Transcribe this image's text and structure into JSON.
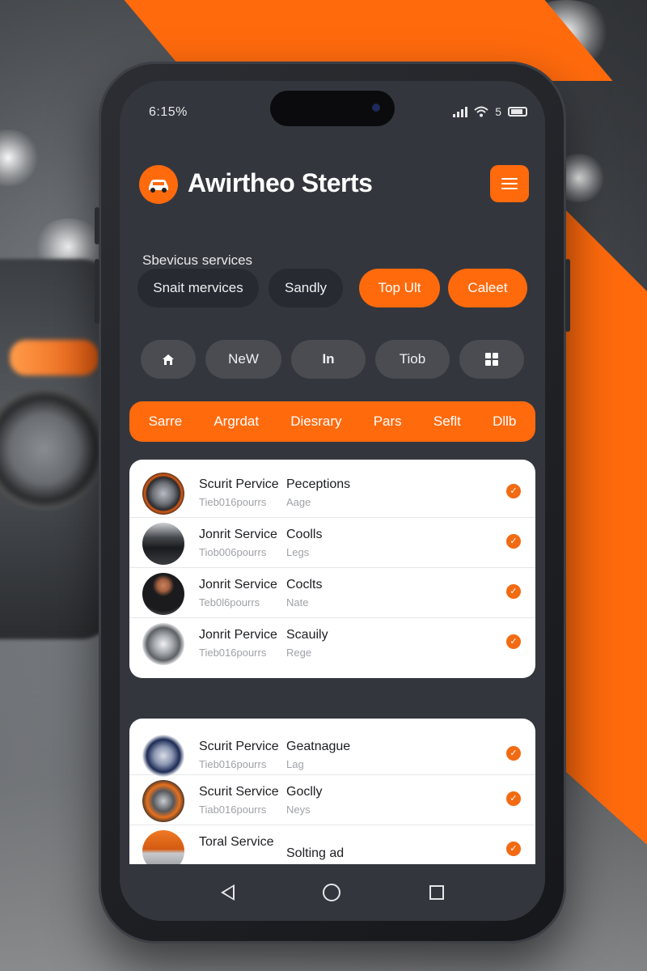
{
  "status_bar": {
    "time": "6:15%",
    "network": "5"
  },
  "header": {
    "app_title": "Awirtheo Sterts",
    "logo_icon": "car-icon",
    "menu_icon": "hamburger-icon"
  },
  "services": {
    "label": "Sbevicus services",
    "chips": [
      {
        "label": "Snait mervices",
        "style": "dark"
      },
      {
        "label": "Sandly",
        "style": "dark"
      },
      {
        "label": "Top Ult",
        "style": "orange"
      },
      {
        "label": "Caleet",
        "style": "orange"
      }
    ]
  },
  "quick_nav": [
    {
      "label": "",
      "icon": "home-icon"
    },
    {
      "label": "NeW"
    },
    {
      "label": "In"
    },
    {
      "label": "Tiob"
    },
    {
      "label": "",
      "icon": "grid-icon"
    }
  ],
  "categories": [
    "Sarre",
    "Argrdat",
    "Diesrary",
    "Pars",
    "Seflt",
    "Dllb"
  ],
  "list_card_1": [
    {
      "title": "Scurit Pervice",
      "title_2": "Peceptions",
      "subtitle": "Tieb016pourrs",
      "subtitle_2": "Aage",
      "avatar": "brake-rotor"
    },
    {
      "title": "Jonrit Service",
      "title_2": "Coolls",
      "subtitle": "Tiob006pourrs",
      "subtitle_2": "Legs",
      "avatar": "car-front"
    },
    {
      "title": "Jonrit Service",
      "title_2": "Coclts",
      "subtitle": "Teb0l6pourrs",
      "subtitle_2": "Nate",
      "avatar": "mechanic"
    },
    {
      "title": "Jonrit Pervice",
      "title_2": "Scauily",
      "subtitle": "Tieb016pourrs",
      "subtitle_2": "Rege",
      "avatar": "wheel-rim"
    }
  ],
  "list_card_2": [
    {
      "title": "Scurit Pervice",
      "title_2": "Geatnague",
      "subtitle": "Tieb016pourrs",
      "subtitle_2": "Lag",
      "avatar": "badge"
    },
    {
      "title": "Scurit Service",
      "title_2": "Goclly",
      "subtitle": "Tiab016pourrs",
      "subtitle_2": "Neys",
      "avatar": "engine"
    },
    {
      "title": "Toral Service",
      "title_2": "Solting ad",
      "subtitle": "",
      "subtitle_2": "",
      "avatar": "orange-part"
    }
  ],
  "colors": {
    "accent": "#ff6a0d",
    "screen_bg": "#34363d",
    "card_bg": "#ffffff"
  }
}
